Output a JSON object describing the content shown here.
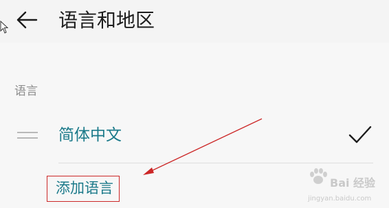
{
  "header": {
    "title": "语言和地区",
    "back_icon": "arrow-left-icon"
  },
  "section": {
    "label": "语言"
  },
  "language_list": {
    "items": [
      {
        "label": "简体中文",
        "selected": true,
        "check_icon": "checkmark-icon",
        "handle_icon": "drag-handle-icon"
      }
    ]
  },
  "actions": {
    "add_language": "添加语言"
  },
  "watermark": {
    "brand": "Bai  经验",
    "url": "jingyan.baidu.com"
  },
  "colors": {
    "accent": "#1b7a8a",
    "annotation": "#cc2727"
  }
}
